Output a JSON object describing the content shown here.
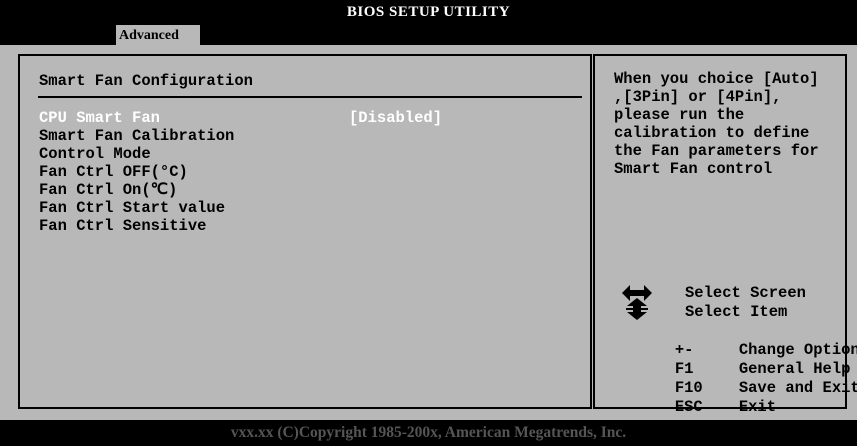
{
  "window": {
    "title": "BIOS SETUP UTILITY"
  },
  "tabs": [
    {
      "label": "Advanced"
    }
  ],
  "left": {
    "section_title": "Smart Fan Configuration",
    "items": [
      {
        "label": "CPU Smart Fan",
        "value": "[Disabled]",
        "selected": true
      },
      {
        "label": "Smart Fan Calibration"
      },
      {
        "label": "Control Mode"
      },
      {
        "label": "Fan Ctrl OFF(°C)"
      },
      {
        "label": "Fan Ctrl On(℃)"
      },
      {
        "label": "Fan Ctrl Start value"
      },
      {
        "label": "Fan Ctrl Sensitive"
      }
    ]
  },
  "right": {
    "help_text": "When you choice [Auto]\n,[3Pin] or [4Pin],\nplease run the\ncalibration to define\nthe Fan parameters for\nSmart Fan control",
    "keys": [
      {
        "key_icon": "left-right-arrow-icon",
        "desc": "Select Screen"
      },
      {
        "key_icon": "up-down-arrow-icon",
        "desc": "Select Item"
      },
      {
        "key": "+-",
        "desc": "Change Option"
      },
      {
        "key": "F1",
        "desc": "General Help"
      },
      {
        "key": "F10",
        "desc": "Save and Exit"
      },
      {
        "key": "ESC",
        "desc": "Exit"
      }
    ]
  },
  "footer": {
    "text": "vxx.xx (C)Copyright 1985-200x, American Megatrends, Inc."
  },
  "colors": {
    "background": "#000000",
    "panel": "#b8b8b8",
    "selected_text": "#ffffff",
    "text": "#000000"
  }
}
